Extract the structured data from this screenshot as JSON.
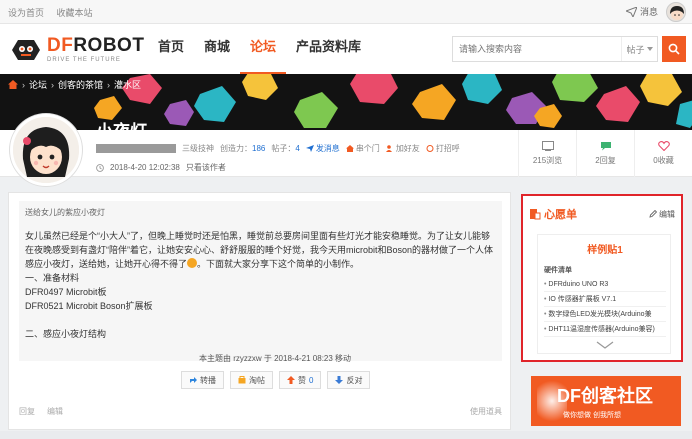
{
  "topbar": {
    "set_home": "设为首页",
    "bookmark": "收藏本站",
    "messages": "消息"
  },
  "logo": {
    "brand_prefix": "DF",
    "brand_suffix": "ROBOT",
    "slogan": "DRIVE THE FUTURE"
  },
  "nav": {
    "items": [
      "首页",
      "商城",
      "论坛",
      "产品资料库"
    ],
    "active_index": 2
  },
  "search": {
    "placeholder": "请输入搜索内容",
    "scope": "帖子"
  },
  "breadcrumb": [
    "论坛",
    "创客的茶馆",
    "灌水区"
  ],
  "post": {
    "title": "小夜灯",
    "author_tag": "三级技神",
    "creativity_label": "创造力：",
    "creativity_value": "186",
    "posts_label": "帖子：",
    "posts_value": "4",
    "send_msg": "发消息",
    "home": "串个门",
    "add_friend": "加好友",
    "greet": "打招呼",
    "time": "2018-4-20 12:02:38",
    "author_only": "只看该作者",
    "quote_title": "送给女儿的紫应小夜灯",
    "body_para1": "女儿虽然已经是个“小大人”了，但晚上睡觉时还是怕黑，睡觉前总要房间里面有些灯光才能安稳睡觉。为了让女儿能够在夜晚感受到有盏灯“陪伴”着它，让她安安心心、舒舒服服的睡个好觉，我今天用microbit和Boson的器材做了一个人体感应小夜灯，送给她，让她开心得不得了",
    "body_para1_tail": "。下面就大家分享下这个简单的小制作。",
    "materials_heading": "一、准备材料",
    "material_1": "DFR0497 Microbit板",
    "material_2": "DFR0521 Microbit Boson扩展板",
    "structure_heading": "二、感应小夜灯结构",
    "move_note": "本主题由 rzyzzxw 于 2018-4-21 08:23 移动",
    "actions": [
      "转播",
      "淘帖",
      "赞",
      "反对"
    ],
    "like_count": "0",
    "footer_reply": "回复",
    "footer_edit": "编辑",
    "footer_report": "使用道具"
  },
  "stats": {
    "views": "215浏览",
    "replies": "2回复",
    "favorites": "0收藏"
  },
  "wishlist": {
    "title": "心愿单",
    "edit": "编辑",
    "subtitle": "样例贴1",
    "list_head": "硬件清单",
    "items": [
      "DFRduino UNO R3",
      "IO 传感器扩展板 V7.1",
      "数字绿色LED发光模块(Arduino兼",
      "DHT11温湿度传感器(Arduino兼容)"
    ]
  },
  "promo": {
    "headline": "DF创客社区",
    "tagline": "做你想做 创我所想"
  },
  "colors": {
    "accent": "#f15a22",
    "link_blue": "#1f6fd1",
    "highlight_border": "#e0242a"
  }
}
